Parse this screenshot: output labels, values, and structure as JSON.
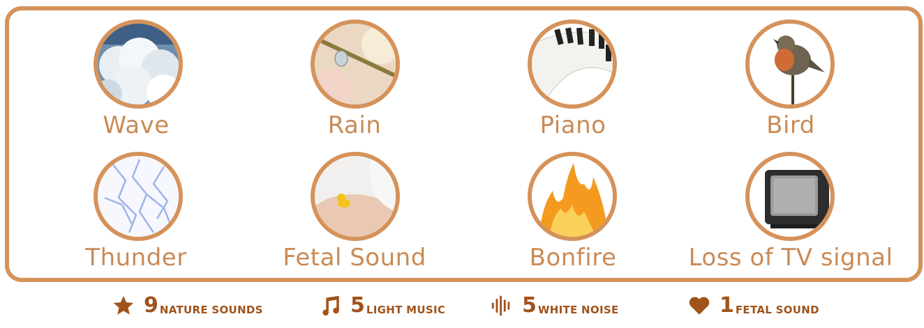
{
  "sounds": [
    {
      "label": "Wave",
      "image": "ocean-wave-image"
    },
    {
      "label": "Rain",
      "image": "raindrop-on-twig-image"
    },
    {
      "label": "Piano",
      "image": "piano-keys-image"
    },
    {
      "label": "Bird",
      "image": "robin-bird-image"
    },
    {
      "label": "Thunder",
      "image": "lightning-image"
    },
    {
      "label": "Fetal Sound",
      "image": "pregnant-belly-duck-image"
    },
    {
      "label": "Bonfire",
      "image": "fire-flames-image"
    },
    {
      "label": "Loss of TV signal",
      "image": "static-tv-image"
    }
  ],
  "stats": [
    {
      "icon": "star-icon",
      "count": "9",
      "text": "NATURE SOUNDS"
    },
    {
      "icon": "music-note-icon",
      "count": "5",
      "text": "LIGHT MUSIC"
    },
    {
      "icon": "sound-wave-icon",
      "count": "5",
      "text": "WHITE NOISE"
    },
    {
      "icon": "heart-icon",
      "count": "1",
      "text": "FETAL SOUND"
    }
  ],
  "colors": {
    "accent": "#d5925a",
    "label": "#c98a55",
    "stats": "#a0531a"
  }
}
